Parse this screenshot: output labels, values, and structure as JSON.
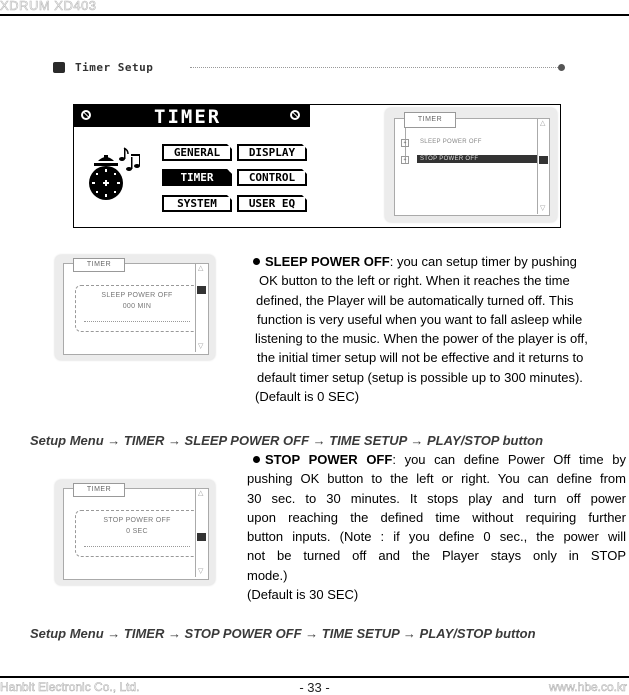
{
  "header": {
    "model": "XDRUM XD403"
  },
  "section": {
    "title": "Timer Setup"
  },
  "lcd": {
    "title": "TIMER",
    "menu": [
      {
        "label": "GENERAL",
        "active": false
      },
      {
        "label": "DISPLAY",
        "active": false
      },
      {
        "label": "TIMER",
        "active": true
      },
      {
        "label": "CONTROL",
        "active": false
      },
      {
        "label": "SYSTEM",
        "active": false
      },
      {
        "label": "USER EQ",
        "active": false
      }
    ],
    "left_icon": "no-sound-icon",
    "right_icon": "no-sound-icon"
  },
  "tree_window": {
    "tab": "TIMER",
    "items": [
      {
        "label": "SLEEP POWER OFF",
        "selected": false
      },
      {
        "label": "STOP POWER OFF",
        "selected": true
      }
    ]
  },
  "sleep_window": {
    "tab": "TIMER",
    "popup_title": "SLEEP POWER OFF",
    "popup_value": "000 MIN"
  },
  "stop_window": {
    "tab": "TIMER",
    "popup_title": "STOP POWER OFF",
    "popup_value": "0 SEC"
  },
  "sleep": {
    "heading": "SLEEP POWER OFF",
    "lines": [
      ": you can setup timer by pushing",
      "OK button to the left or right. When it reaches the time",
      "defined, the Player will be automatically turned off. This",
      "function is very useful when you want to fall asleep while",
      "listening to the music. When the power of the player is off,",
      "the initial timer setup will not be effective and it returns to",
      "default timer setup (setup is possible up to 300 minutes).",
      "(Default is 0 SEC)"
    ],
    "path": "Setup Menu → TIMER → SLEEP POWER OFF → TIME SETUP → PLAY/STOP button"
  },
  "stop": {
    "heading": "STOP POWER OFF",
    "lines": [
      ": you can define Power Off time by",
      "pushing OK button to the left or right. You can define from",
      "30 sec. to 30 minutes. It stops play and turn off power",
      "upon reaching the defined time without requiring further",
      "button inputs. (Note : if you define 0 sec., the power will",
      "not be turned off and the Player stays only in STOP",
      "mode.)",
      "(Default is 30 SEC)"
    ],
    "path": "Setup Menu → TIMER → STOP POWER OFF → TIME SETUP → PLAY/STOP button"
  },
  "footer": {
    "company": "Hanbit Electronic Co., Ltd.",
    "page": "- 33 -",
    "website": "www.hbe.co.kr"
  }
}
